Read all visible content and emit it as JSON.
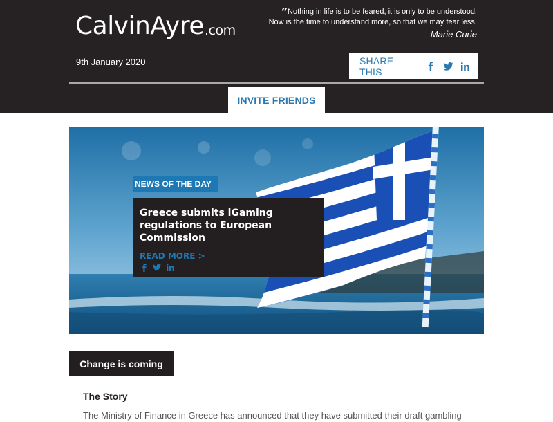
{
  "header": {
    "logo": {
      "name": "CalvinAyre",
      "suffix": ".com"
    },
    "quote": {
      "line1": "Nothing in life is to be feared, it is only to be understood.",
      "line2": "Now is the time to understand more, so that we may fear less.",
      "author": "—Marie Curie"
    },
    "date": "9th January 2020",
    "share": {
      "label": "SHARE THIS",
      "icons": [
        "facebook-icon",
        "twitter-icon",
        "linkedin-icon"
      ]
    },
    "invite_label": "INVITE FRIENDS"
  },
  "hero": {
    "tag": "NEWS OF THE DAY",
    "title": "Greece submits iGaming regulations to European Commission",
    "read_more": "READ MORE >",
    "icons": [
      "facebook-icon",
      "twitter-icon",
      "linkedin-icon"
    ]
  },
  "section": {
    "button_label": "Change is coming",
    "story_heading": "The Story",
    "story_text": "The Ministry of Finance in Greece has announced that they have submitted their draft gambling"
  },
  "colors": {
    "header_bg": "#262223",
    "accent_blue": "#1e78b4",
    "link_blue": "#2a7ab0",
    "card_bg": "#231f20"
  }
}
